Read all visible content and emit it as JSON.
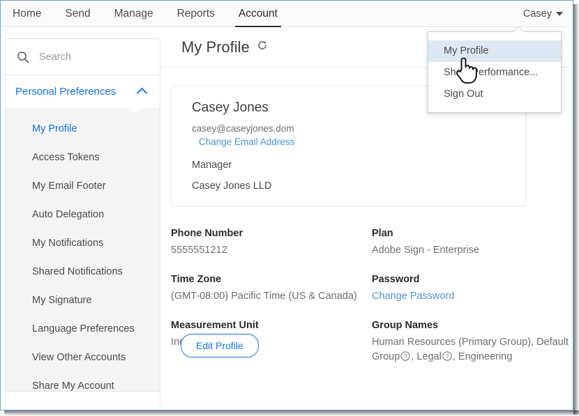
{
  "topnav": {
    "tabs": [
      {
        "label": "Home",
        "active": false
      },
      {
        "label": "Send",
        "active": false
      },
      {
        "label": "Manage",
        "active": false
      },
      {
        "label": "Reports",
        "active": false
      },
      {
        "label": "Account",
        "active": true
      }
    ],
    "user_label": "Casey"
  },
  "user_dropdown": {
    "items": [
      {
        "label": "My Profile",
        "highlighted": true
      },
      {
        "label": "Show Performance...",
        "highlighted": false
      },
      {
        "label": "Sign Out",
        "highlighted": false
      }
    ]
  },
  "sidebar": {
    "search_placeholder": "Search",
    "search_value": "",
    "section_label": "Personal Preferences",
    "items": [
      {
        "label": "My Profile",
        "selected": true
      },
      {
        "label": "Access Tokens",
        "selected": false
      },
      {
        "label": "My Email Footer",
        "selected": false
      },
      {
        "label": "Auto Delegation",
        "selected": false
      },
      {
        "label": "My Notifications",
        "selected": false
      },
      {
        "label": "Shared Notifications",
        "selected": false
      },
      {
        "label": "My Signature",
        "selected": false
      },
      {
        "label": "Language Preferences",
        "selected": false
      },
      {
        "label": "View Other Accounts",
        "selected": false
      },
      {
        "label": "Share My Account",
        "selected": false
      }
    ]
  },
  "main": {
    "page_title": "My Profile",
    "card": {
      "name": "Casey Jones",
      "email": "casey@caseyjones.dom",
      "change_email_label": "Change Email Address",
      "role": "Manager",
      "company": "Casey Jones LLD"
    },
    "details": {
      "left": [
        {
          "label": "Phone Number",
          "value": "5555551212"
        },
        {
          "label": "Time Zone",
          "value": "(GMT-08:00) Pacific Time (US & Canada)"
        },
        {
          "label": "Measurement Unit",
          "value": "Inches(in)"
        }
      ],
      "right": {
        "plan_label": "Plan",
        "plan_value": "Adobe Sign - Enterprise",
        "password_label": "Password",
        "change_password_label": "Change Password",
        "group_names_label": "Group Names",
        "group_part_1": "Human Resources (Primary Group), Default Group",
        "group_part_2": ", Legal",
        "group_part_3": ", Engineering"
      }
    },
    "edit_profile_label": "Edit Profile"
  },
  "colors": {
    "accent_blue": "#1473e6",
    "link_blue": "#4b94d8",
    "highlight_bg": "#dce9f5",
    "frame_border": "#6ba4d8",
    "sidebar_bg": "#f4f4f4"
  },
  "icons": {
    "search": "search-icon",
    "caret_down": "caret-down-icon",
    "chevron_up": "chevron-up-icon",
    "refresh": "refresh-icon",
    "help": "help-circle-icon",
    "cursor": "pointer-hand-cursor"
  }
}
